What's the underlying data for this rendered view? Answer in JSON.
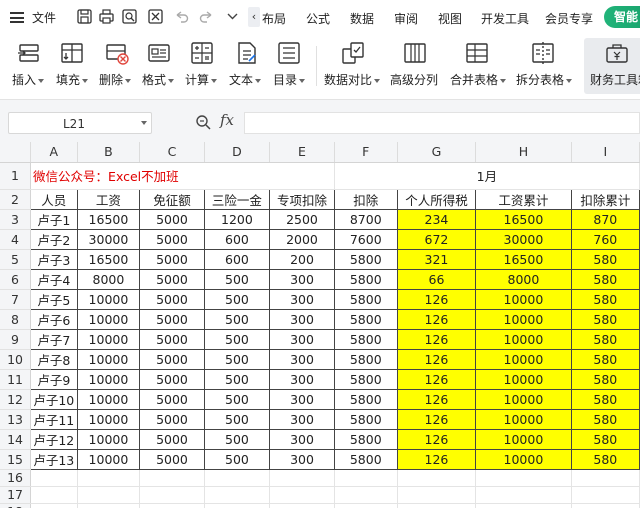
{
  "menubar": {
    "file_label": "文件",
    "tabs": [
      "布局",
      "公式",
      "数据",
      "审阅",
      "视图",
      "开发工具",
      "会员专享"
    ],
    "smart_label": "智能"
  },
  "ribbon": {
    "buttons": [
      {
        "label": "插入",
        "icon": "insert-icon"
      },
      {
        "label": "填充",
        "icon": "fill-icon"
      },
      {
        "label": "删除",
        "icon": "delete-icon"
      },
      {
        "label": "格式",
        "icon": "format-icon"
      },
      {
        "label": "计算",
        "icon": "calculate-icon"
      },
      {
        "label": "文本",
        "icon": "text-icon"
      },
      {
        "label": "目录",
        "icon": "catalog-icon"
      },
      {
        "label": "数据对比",
        "icon": "data-compare-icon"
      },
      {
        "label": "高级分列",
        "icon": "advanced-split-icon"
      },
      {
        "label": "合并表格",
        "icon": "merge-table-icon"
      },
      {
        "label": "拆分表格",
        "icon": "split-table-icon"
      },
      {
        "label": "财务工具箱",
        "icon": "finance-toolbox-icon"
      }
    ]
  },
  "formula": {
    "name_box": "L21",
    "fx": "fx",
    "content": ""
  },
  "sheet": {
    "columns": [
      "A",
      "B",
      "C",
      "D",
      "E",
      "F",
      "G",
      "H",
      "I"
    ],
    "row_numbers": [
      "1",
      "2",
      "3",
      "4",
      "5",
      "6",
      "7",
      "8",
      "9",
      "10",
      "11",
      "12",
      "13",
      "14",
      "15",
      "16",
      "17",
      "18"
    ],
    "title": "微信公众号：Excel不加班",
    "month": "1月",
    "headers": [
      "人员",
      "工资",
      "免征额",
      "三险一金",
      "专项扣除",
      "扣除",
      "个人所得税",
      "工资累计",
      "扣除累计"
    ],
    "rows": [
      [
        "卢子1",
        "16500",
        "5000",
        "1200",
        "2500",
        "8700",
        "234",
        "16500",
        "870"
      ],
      [
        "卢子2",
        "30000",
        "5000",
        "600",
        "2000",
        "7600",
        "672",
        "30000",
        "760"
      ],
      [
        "卢子3",
        "16500",
        "5000",
        "600",
        "200",
        "5800",
        "321",
        "16500",
        "580"
      ],
      [
        "卢子4",
        "8000",
        "5000",
        "500",
        "300",
        "5800",
        "66",
        "8000",
        "580"
      ],
      [
        "卢子5",
        "10000",
        "5000",
        "500",
        "300",
        "5800",
        "126",
        "10000",
        "580"
      ],
      [
        "卢子6",
        "10000",
        "5000",
        "500",
        "300",
        "5800",
        "126",
        "10000",
        "580"
      ],
      [
        "卢子7",
        "10000",
        "5000",
        "500",
        "300",
        "5800",
        "126",
        "10000",
        "580"
      ],
      [
        "卢子8",
        "10000",
        "5000",
        "500",
        "300",
        "5800",
        "126",
        "10000",
        "580"
      ],
      [
        "卢子9",
        "10000",
        "5000",
        "500",
        "300",
        "5800",
        "126",
        "10000",
        "580"
      ],
      [
        "卢子10",
        "10000",
        "5000",
        "500",
        "300",
        "5800",
        "126",
        "10000",
        "580"
      ],
      [
        "卢子11",
        "10000",
        "5000",
        "500",
        "300",
        "5800",
        "126",
        "10000",
        "580"
      ],
      [
        "卢子12",
        "10000",
        "5000",
        "500",
        "300",
        "5800",
        "126",
        "10000",
        "580"
      ],
      [
        "卢子13",
        "10000",
        "5000",
        "500",
        "300",
        "5800",
        "126",
        "10000",
        "580"
      ]
    ],
    "highlight_color": "#ffff00",
    "title_color": "#e00000"
  }
}
